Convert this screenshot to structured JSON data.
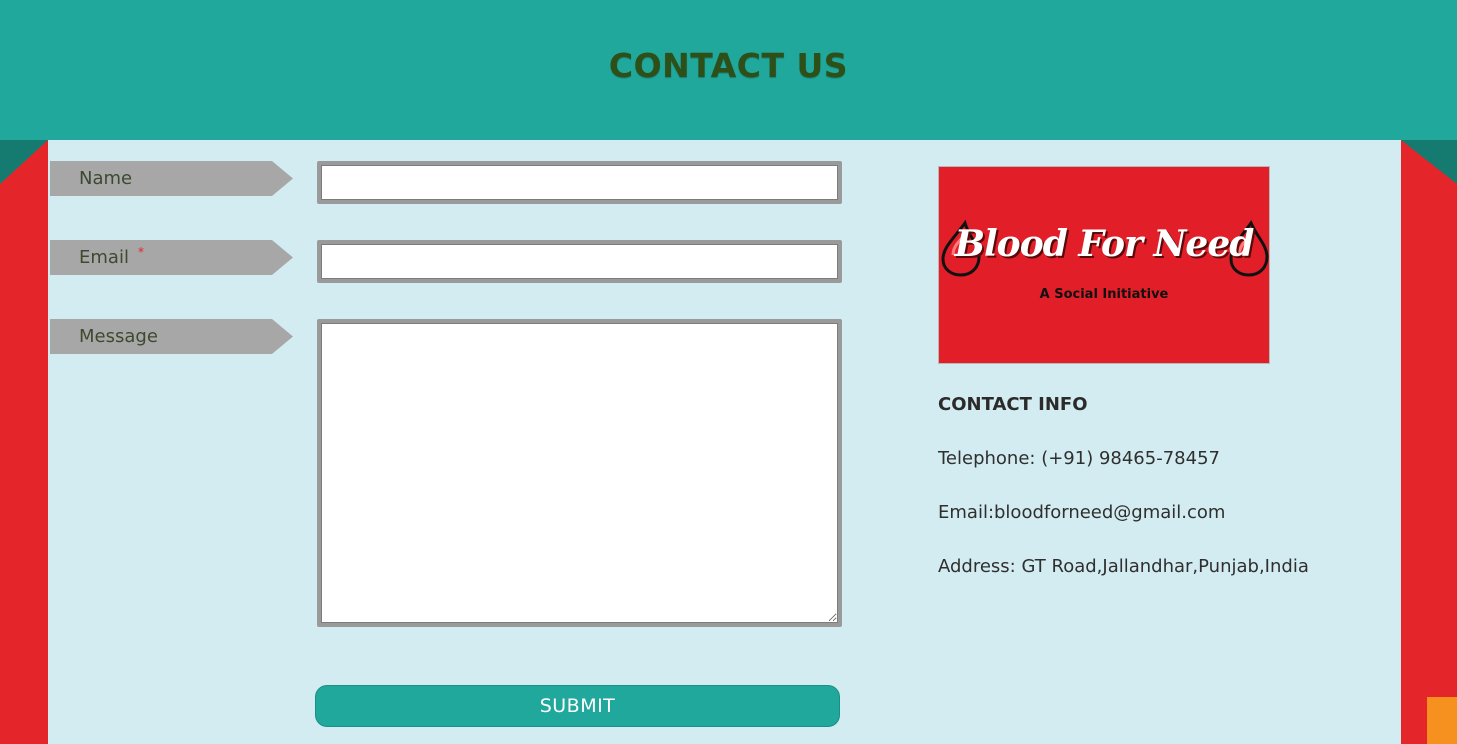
{
  "header": {
    "title": "CONTACT US"
  },
  "form": {
    "name_label": "Name",
    "email_label": "Email",
    "required_mark": "*",
    "message_label": "Message",
    "name_value": "",
    "email_value": "",
    "message_value": "",
    "submit_label": "SUBMIT"
  },
  "logo": {
    "title": "Blood For Need",
    "tagline": "A Social Initiative"
  },
  "contact_info": {
    "heading": "CONTACT INFO",
    "telephone": "Telephone: (+91) 98465-78457",
    "email": "Email:bloodforneed@gmail.com",
    "address": "Address: GT Road,Jallandhar,Punjab,India"
  },
  "colors": {
    "teal": "#20a89c",
    "red": "#e4262a",
    "panel": "#d3ecf1",
    "label_gray": "#a7a7a7",
    "orange": "#f6901e"
  }
}
